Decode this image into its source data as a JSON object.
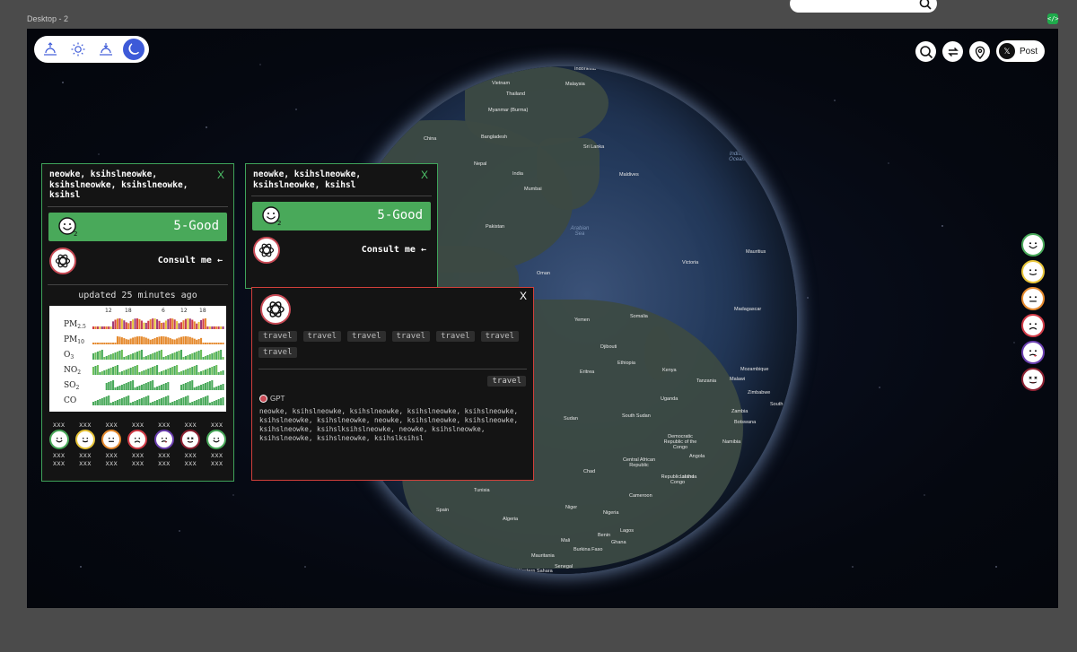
{
  "frame": {
    "label": "Desktop - 2"
  },
  "toolbar": {
    "icons": [
      "sunrise-icon",
      "sun-icon",
      "sunset-icon",
      "moon-icon"
    ],
    "active": "moon-icon"
  },
  "topright": {
    "post_label": "Post",
    "x_glyph": "𝕏"
  },
  "legend_levels": [
    {
      "level": "Good",
      "color": "#49a95a"
    },
    {
      "level": "Moderate",
      "color": "#e8c53a"
    },
    {
      "level": "Unhealthy for sensitive",
      "color": "#e58a2e"
    },
    {
      "level": "Unhealthy",
      "color": "#d23c48"
    },
    {
      "level": "Very unhealthy",
      "color": "#6b3fb0"
    },
    {
      "level": "Hazardous",
      "color": "#8e2233"
    }
  ],
  "card_left": {
    "title": "neowke, ksihslneowke, ksihslneowke, ksihslneowke, ksihsl",
    "close": "X",
    "aqi_value": "5-Good",
    "consult": "Consult me ←",
    "updated": "updated 25 minutes ago",
    "pollutants": [
      "PM2.5",
      "PM10",
      "O3",
      "NO2",
      "SO2",
      "CO"
    ],
    "hour_ticks": [
      "12",
      "18",
      "6",
      "12",
      "18"
    ],
    "forecast": [
      {
        "top": "xxx",
        "bottom": "xxx xxx",
        "level": "good"
      },
      {
        "top": "xxx",
        "bottom": "xxx xxx",
        "level": "moderate"
      },
      {
        "top": "xxx",
        "bottom": "xxx xxx",
        "level": "usg"
      },
      {
        "top": "xxx",
        "bottom": "xxx xxx",
        "level": "unhealthy"
      },
      {
        "top": "xxx",
        "bottom": "xxx xxx",
        "level": "very-unhealthy"
      },
      {
        "top": "xxx",
        "bottom": "xxx xxx",
        "level": "hazardous"
      },
      {
        "top": "xxx",
        "bottom": "xxx xxx",
        "level": "good"
      }
    ]
  },
  "card_right": {
    "title": "neowke, ksihslneowke, ksihslneowke, ksihsl",
    "close": "X",
    "aqi_value": "5-Good",
    "consult": "Consult me ←"
  },
  "popup": {
    "close": "X",
    "tags": [
      "travel",
      "travel",
      "travel",
      "travel",
      "travel",
      "travel",
      "travel"
    ],
    "selected_tag": "travel",
    "source": "GPT",
    "response": "neowke, ksihslneowke, ksihslneowke, ksihslneowke, ksihslneowke, ksihslneowke, ksihslneowke, neowke, ksihslneowke, ksihslneowke, ksihslneowke, ksihslksihslneowke, neowke, ksihslneowke, ksihslneowke, ksihslneowke, ksihslksihsl"
  },
  "map_labels": [
    "Philippines",
    "Vietnam",
    "Malaysia",
    "Indonesia",
    "Thailand",
    "Myanmar (Burma)",
    "Bangladesh",
    "China",
    "Sri Lanka",
    "Nepal",
    "India",
    "Maldives",
    "Mumbai",
    "Pakistan",
    "Indian Ocean",
    "Arabian Sea",
    "Oman",
    "Yemen",
    "Somalia",
    "Victoria",
    "Mauritius",
    "Madagascar",
    "Ethiopia",
    "Kenya",
    "Tanzania",
    "Mozambique",
    "Sudan",
    "South Sudan",
    "Zimbabwe",
    "Zambia",
    "Botswana",
    "South Africa",
    "Malawi",
    "Uganda",
    "Djibouti",
    "Eritrea",
    "Democratic Republic of the Congo",
    "Namibia",
    "Angola",
    "Chad",
    "Central African Republic",
    "Cameroon",
    "Niger",
    "Nigeria",
    "Algeria",
    "Tunisia",
    "Spain",
    "Mali",
    "Ghana",
    "Burkina Faso",
    "Mauritania",
    "Senegal",
    "Benin",
    "Lagos",
    "Republic of the Congo",
    "Luanda",
    "Western Sahara"
  ]
}
